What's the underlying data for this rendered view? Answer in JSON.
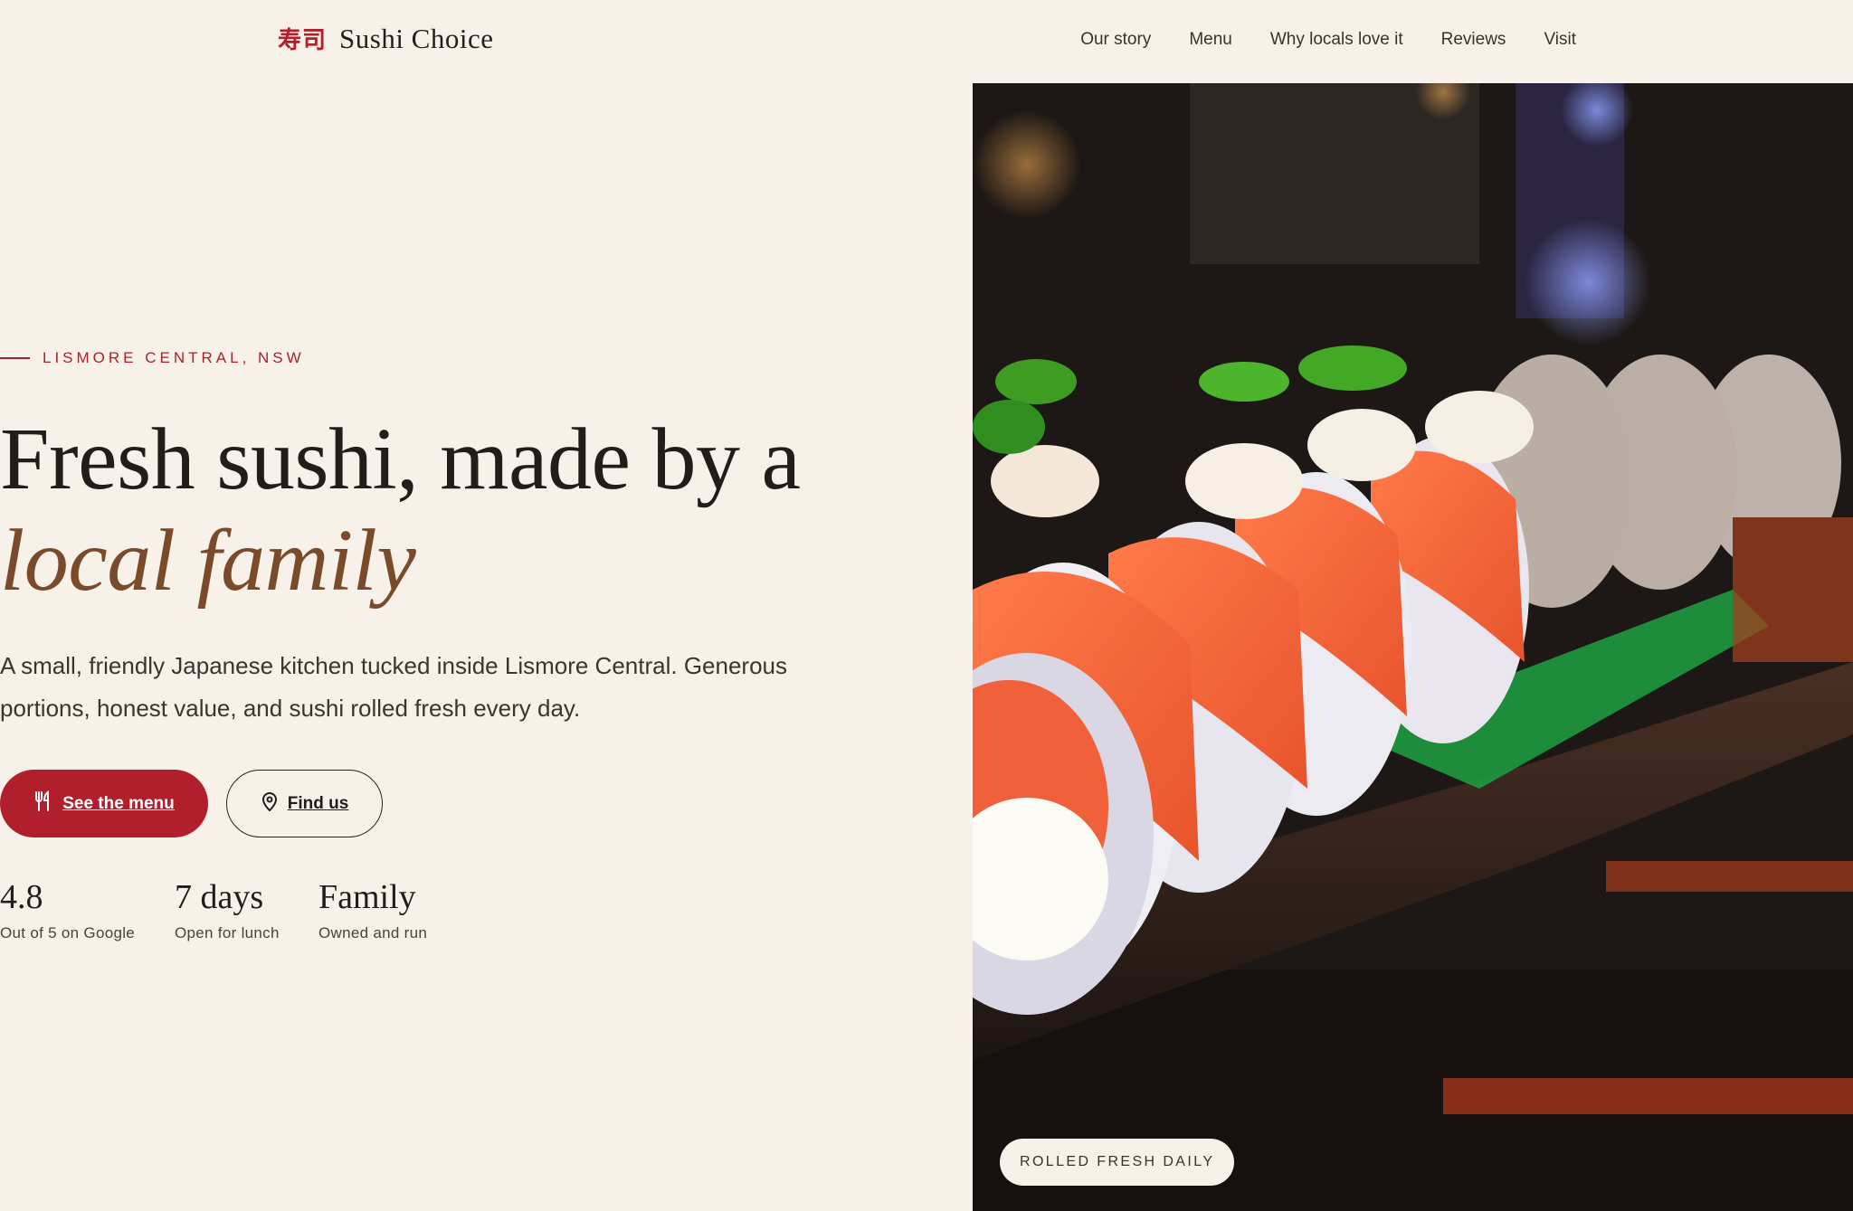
{
  "brand": {
    "mark": "寿司",
    "name": "Sushi Choice"
  },
  "nav": {
    "items": [
      "Our story",
      "Menu",
      "Why locals love it",
      "Reviews",
      "Visit"
    ]
  },
  "hero": {
    "eyebrow": "LISMORE CENTRAL, NSW",
    "headline_line1": "Fresh sushi, made by a",
    "headline_line2": "local family",
    "lead": "A small, friendly Japanese kitchen tucked inside Lismore Central. Generous portions, honest value, and sushi rolled fresh every day.",
    "primary_button": {
      "label": "See the menu",
      "icon": "utensils-icon"
    },
    "secondary_button": {
      "label": "Find us",
      "icon": "map-pin-icon"
    },
    "stats": [
      {
        "value": "4.8",
        "label": "Out of 5 on Google"
      },
      {
        "value": "7 days",
        "label": "Open for lunch"
      },
      {
        "value": "Family",
        "label": "Owned and run"
      }
    ],
    "photo_tag": "ROLLED FRESH DAILY"
  },
  "colors": {
    "background": "#f7f1e9",
    "accent_red": "#b21f2c",
    "accent_brown": "#7a4b2a",
    "text": "#241f1b"
  }
}
